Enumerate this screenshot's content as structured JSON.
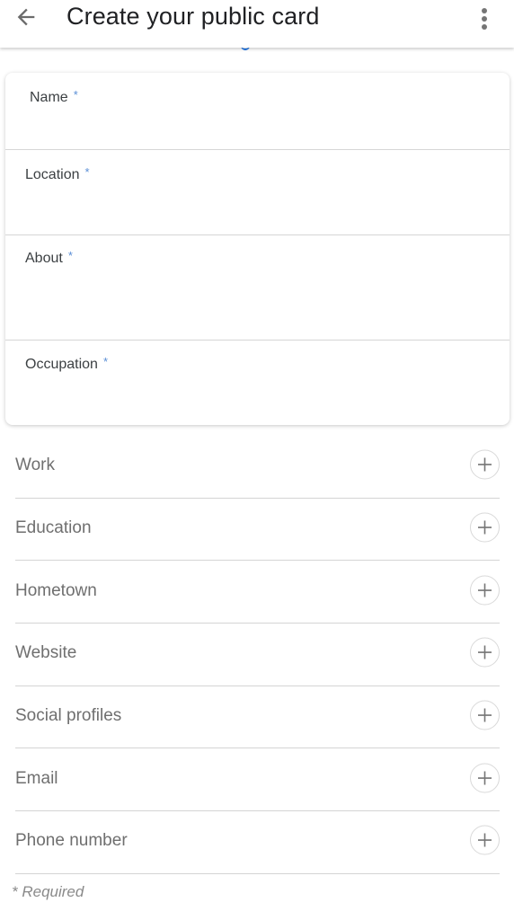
{
  "appbar": {
    "title": "Create your public card",
    "back_icon": "arrow-left-icon",
    "more_icon": "more-vert-icon"
  },
  "required_fields": [
    {
      "label": "Name",
      "required_marker": "*",
      "value": ""
    },
    {
      "label": "Location",
      "required_marker": "*",
      "value": ""
    },
    {
      "label": "About",
      "required_marker": "*",
      "value": ""
    },
    {
      "label": "Occupation",
      "required_marker": "*",
      "value": ""
    }
  ],
  "optional_sections": [
    {
      "label": "Work",
      "icon": "add-circle-icon"
    },
    {
      "label": "Education",
      "icon": "add-circle-icon"
    },
    {
      "label": "Hometown",
      "icon": "add-circle-icon"
    },
    {
      "label": "Website",
      "icon": "add-circle-icon"
    },
    {
      "label": "Social profiles",
      "icon": "add-circle-icon"
    },
    {
      "label": "Email",
      "icon": "add-circle-icon"
    },
    {
      "label": "Phone number",
      "icon": "add-circle-icon"
    }
  ],
  "footer": {
    "required_note": "* Required"
  },
  "colors": {
    "accent": "#1a73e8",
    "required_star": "#5b8fd6",
    "label_text": "#3c4043",
    "row_text": "#6f6f6f"
  }
}
